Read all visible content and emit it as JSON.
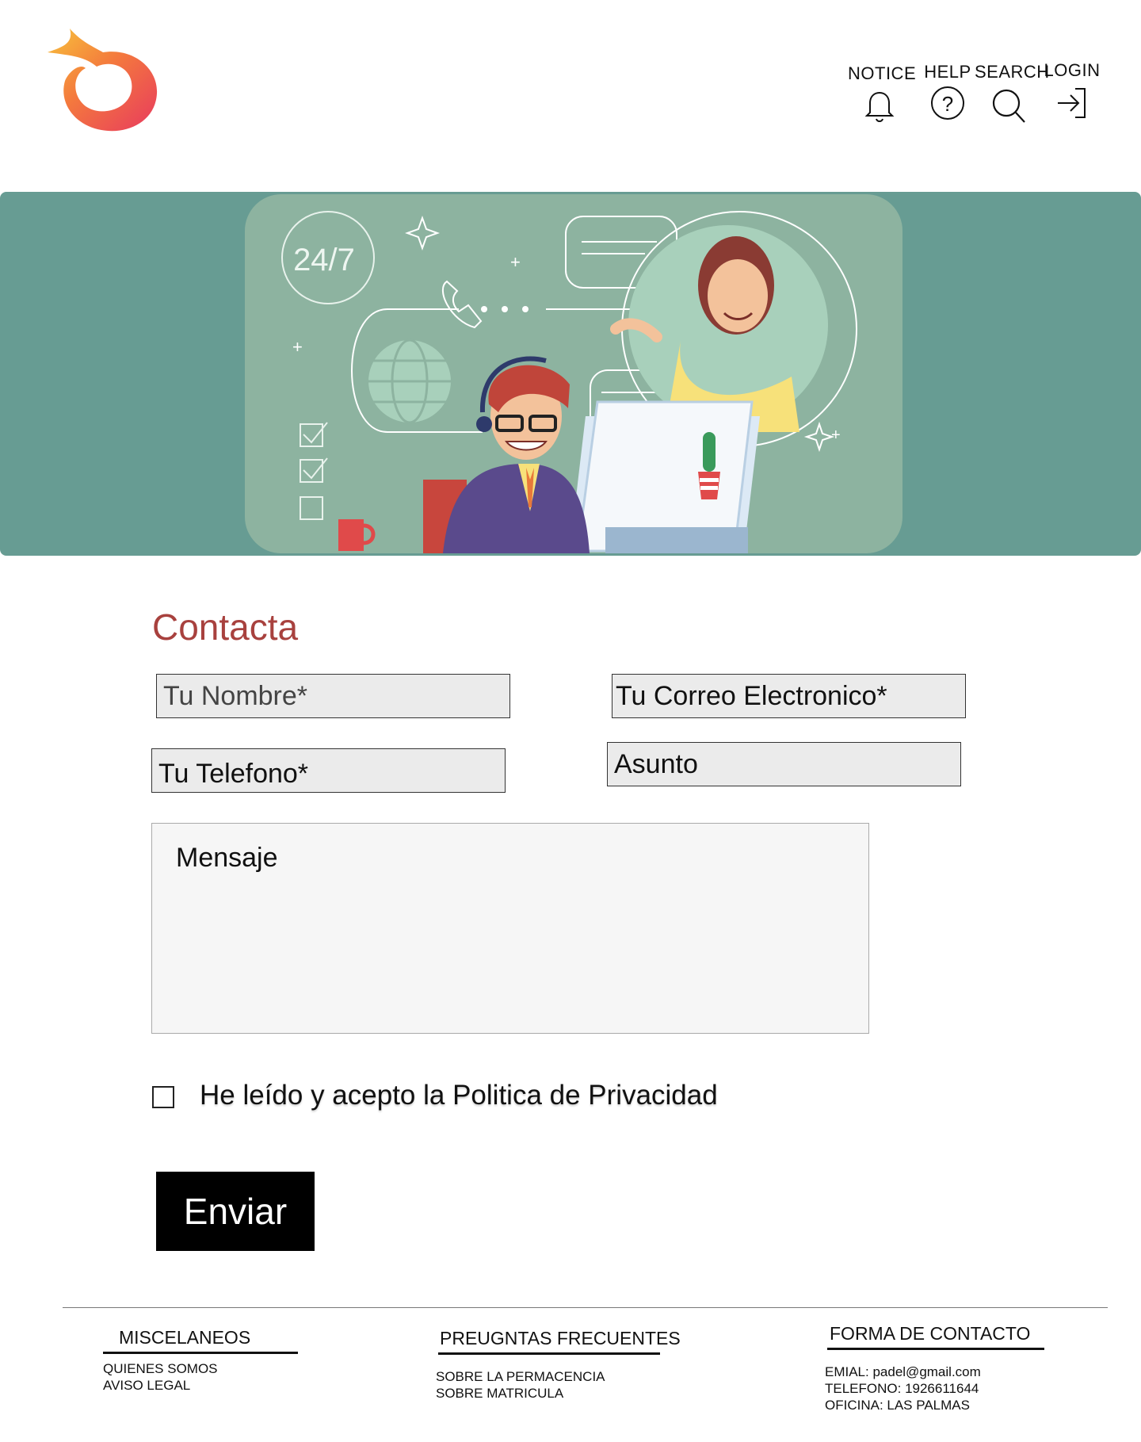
{
  "header": {
    "nav": [
      {
        "label": "NOTICE",
        "icon": "bell-icon"
      },
      {
        "label": "HELP",
        "icon": "help-circle-icon"
      },
      {
        "label": "SEARCH",
        "icon": "search-icon"
      },
      {
        "label": "LOGIN",
        "icon": "login-icon"
      }
    ]
  },
  "hero": {
    "badge_text": "24/7"
  },
  "form": {
    "title": "Contacta",
    "name_placeholder": "Tu Nombre*",
    "email_placeholder": "Tu Correo Electronico*",
    "phone_placeholder": "Tu Telefono*",
    "subject_placeholder": "Asunto",
    "message_placeholder": "Mensaje",
    "privacy_label": "He leído y acepto la Politica de Privacidad",
    "submit_label": "Enviar"
  },
  "footer": {
    "col1": {
      "heading": "MISCELANEOS",
      "links": [
        "QUIENES SOMOS",
        "AVISO LEGAL"
      ]
    },
    "col2": {
      "heading": "PREUGNTAS FRECUENTES",
      "links": [
        "SOBRE LA PERMACENCIA",
        "SOBRE MATRICULA"
      ]
    },
    "col3": {
      "heading": "FORMA DE CONTACTO",
      "lines": [
        "EMIAL: padel@gmail.com",
        "TELEFONO: 1926611644",
        "OFICINA: LAS PALMAS"
      ]
    }
  },
  "colors": {
    "accent": "#a8413e",
    "hero_bg": "#679c93",
    "hero_card": "#8db3a0",
    "logo_red": "#e83a5e",
    "logo_orange": "#f7a23b"
  }
}
